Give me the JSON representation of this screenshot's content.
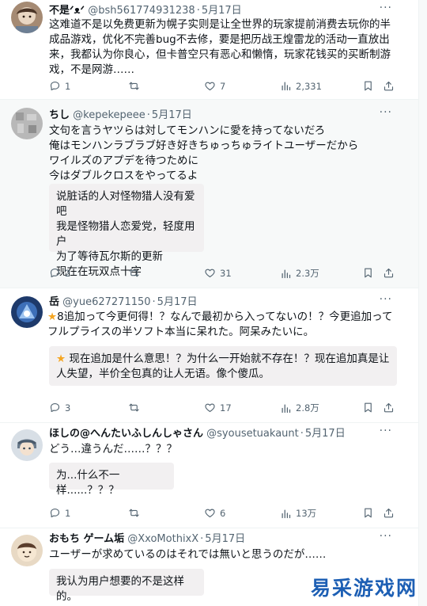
{
  "tweets": [
    {
      "name": "不是ᐟᴥᐟ",
      "handle": "@bsh561774931238",
      "date": "5月17日",
      "text": "这难道不是以免费更新为幌子实则是让全世界的玩家提前消费去玩你的半成品游戏，优化不完善bug不去修，要是把历战王煌雷龙的活动一直放出来，我都认为你良心，但卡普空只有恶心和懒惰，玩家花钱买的买断制游戏，不是网游……",
      "replies": "1",
      "retweets": "",
      "likes": "7",
      "views": "2,331"
    },
    {
      "name": "ちし",
      "handle": "@kepekepeee",
      "date": "5月17日",
      "text_lines": [
        "文句を言うヤツらは対してモンハンに愛を持ってないだろ",
        "俺はモンハンラブラブ好き好きちゅっちゅライトユーザーだから",
        "ワイルズのアプデを待つために",
        "今はダブルクロスをやってるよ"
      ],
      "translation_lines": [
        "说脏话的人对怪物猎人没有爱吧",
        "我是怪物猎人恋爱党，轻度用户",
        "为了等待瓦尔斯的更新",
        "现在在玩双点十字"
      ],
      "replies": "2",
      "retweets": "",
      "likes": "31",
      "views": "2.3万"
    },
    {
      "name": "岳",
      "handle": "@yue627271150",
      "date": "5月17日",
      "text": "8追加って今更何得！？なんで最初から入ってないの！？今更追加ってフルプライスの半ソフト本当に呆れた。阿呆みたいに。",
      "translation": "现在追加是什么意思！？为什么一开始就不存在！？现在追加真是让人失望，半价全包真的让人无语。像个傻瓜。",
      "replies": "3",
      "retweets": "",
      "likes": "17",
      "views": "2.8万"
    },
    {
      "name": "ほしの@へんたいふしんしゃさん",
      "handle": "@syousetuakaunt",
      "date": "5月17日",
      "text": "どう…違うんだ……？？？",
      "translation": "为...什么不一样......？？？",
      "replies": "1",
      "retweets": "",
      "likes": "6",
      "views": "13万"
    },
    {
      "name": "おもち ゲーム垢",
      "handle": "@XxoMothixX",
      "date": "5月17日",
      "text": "ユーザーが求めているのはそれでは無いと思うのだが……",
      "translation": "我认为用户想要的不是这样的。"
    }
  ],
  "watermark": "易采游戏网",
  "icons": {
    "star": "star-icon",
    "reply": "reply-icon",
    "retweet": "retweet-icon",
    "like": "heart-icon",
    "views": "views-icon",
    "bookmark": "bookmark-icon",
    "share": "share-icon",
    "more": "more-icon"
  },
  "colors": {
    "text": "#0f1419",
    "secondary": "#536471",
    "translation_bg": "#f2f0f1",
    "highlight_bg": "#f7f9f9",
    "star": "#f5a623",
    "watermark": "#1d5fb4"
  }
}
